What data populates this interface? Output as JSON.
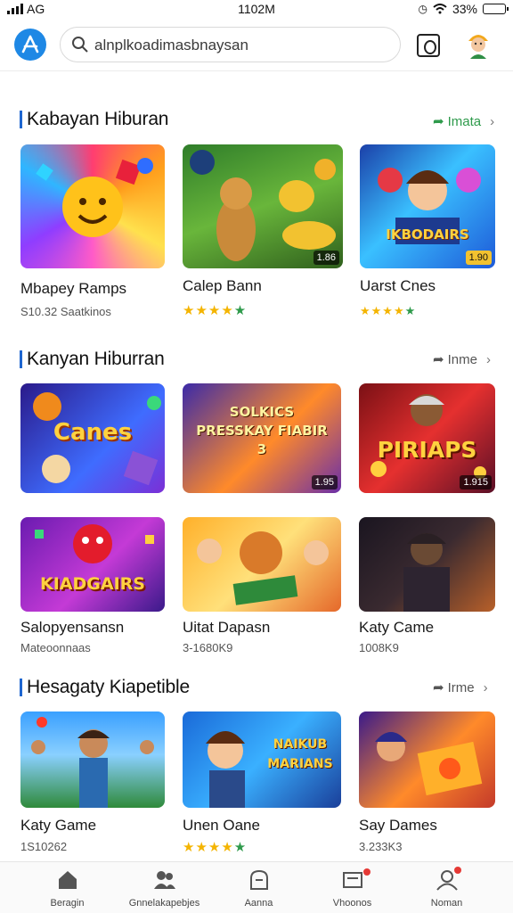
{
  "status_bar": {
    "carrier": "AG",
    "time": "1102M",
    "battery": "33%",
    "battery_level": 0.33
  },
  "header": {
    "search_text": "alnplkoadimasbnaysan",
    "logo_icon": "app-store-logo-icon",
    "camera_icon": "camera-scan-icon",
    "avatar_icon": "profile-avatar-icon"
  },
  "sections": [
    {
      "title": "Kabayan Hiburan",
      "more_label": "Imata",
      "cards": [
        {
          "title": "Mbapey Ramps",
          "subtitle": "S10.32 Saatkinos",
          "image_text": "",
          "tag": ""
        },
        {
          "title": "Calep Bann",
          "rating": 4.5,
          "image_text": "",
          "tag": "1.86"
        },
        {
          "title": "Uarst Cnes",
          "rating": 4.5,
          "image_text": "IKBODAIRS",
          "tag": "1.90"
        }
      ]
    },
    {
      "title": "Kanyan Hiburran",
      "more_label": "Inme",
      "cards": [
        {
          "image_text": "Canes",
          "tag": ""
        },
        {
          "image_text": "SOLKICS PRESSKAY FIABIR 3",
          "tag": "1.95"
        },
        {
          "image_text": "PIRIAPS",
          "tag": "1.915"
        },
        {
          "title": "Salopyensansn",
          "subtitle": "Mateoonnaas",
          "image_text": "KIADGAIRS"
        },
        {
          "title": "Uitat Dapasn",
          "subtitle": "3-1680K9",
          "image_text": ""
        },
        {
          "title": "Katy Came",
          "subtitle": "1008K9",
          "image_text": ""
        }
      ]
    },
    {
      "title": "Hesagaty Kiapetible",
      "more_label": "Irme",
      "cards": [
        {
          "title": "Katy Game",
          "subtitle": "1S10262",
          "image_text": ""
        },
        {
          "title": "Unen Oane",
          "rating": 4.5,
          "image_text": "NAIKUB MARIANS"
        },
        {
          "title": "Say Dames",
          "subtitle": "3.233K3",
          "image_text": ""
        }
      ]
    }
  ],
  "bottom_nav": [
    {
      "label": "Beragin",
      "icon": "home-icon"
    },
    {
      "label": "Gnnelakapebjes",
      "icon": "people-icon"
    },
    {
      "label": "Aanna",
      "icon": "bag-icon"
    },
    {
      "label": "Vhoonos",
      "icon": "mail-icon"
    },
    {
      "label": "Noman",
      "icon": "person-icon"
    }
  ],
  "colors": {
    "accent_blue": "#1e88e5",
    "green": "#2e9a4b",
    "star": "#f4b400",
    "badge_red": "#e53935"
  }
}
